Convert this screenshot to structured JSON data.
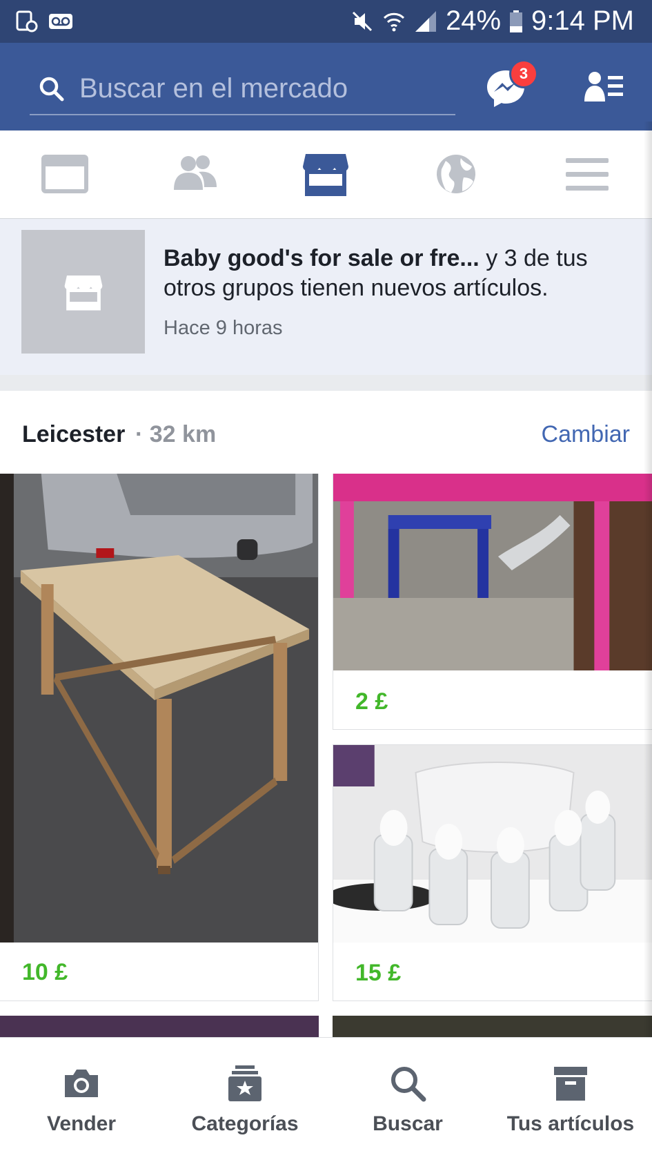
{
  "status_bar": {
    "battery": "24%",
    "time": "9:14 PM"
  },
  "header": {
    "search_placeholder": "Buscar en el mercado",
    "messenger_badge": "3"
  },
  "tabs": [
    {
      "icon": "news-feed-icon"
    },
    {
      "icon": "groups-icon"
    },
    {
      "icon": "marketplace-icon",
      "active": true
    },
    {
      "icon": "globe-icon"
    },
    {
      "icon": "menu-icon"
    }
  ],
  "notification": {
    "group_name": "Baby good's for sale or fre...",
    "message": " y 3 de tus otros grupos tienen nuevos artículos.",
    "time": "Hace 9 horas"
  },
  "location": {
    "city": "Leicester",
    "distance": "· 32 km",
    "change_label": "Cambiar"
  },
  "listings": [
    {
      "price": "10 £",
      "photo": "wooden-table-photo"
    },
    {
      "price": "2 £",
      "photo": "pink-table-photo"
    },
    {
      "price": "15 £",
      "photo": "baby-bottles-photo"
    }
  ],
  "bottom_bar": {
    "sell": "Vender",
    "categories": "Categorías",
    "search": "Buscar",
    "your_items": "Tus artículos"
  },
  "colors": {
    "brand": "#3b5998",
    "status_bar": "#2f4574",
    "price": "#42b72a",
    "link": "#4267b2",
    "badge": "#fa3e3e"
  }
}
